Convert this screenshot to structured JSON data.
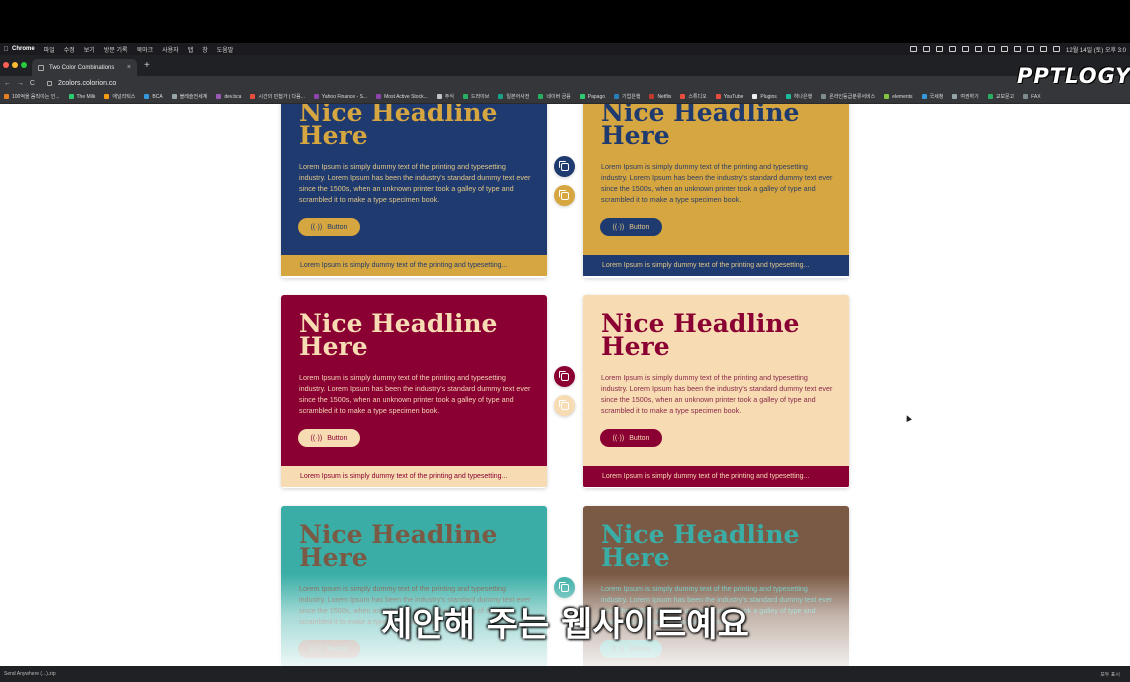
{
  "menubar": {
    "items": [
      "Chrome",
      "파일",
      "수정",
      "보기",
      "방문 기록",
      "북마크",
      "사용자",
      "탭",
      "창",
      "도움말"
    ],
    "clock": "12월 14일 (토) 오후 3:0"
  },
  "tab": {
    "title": "Two Color Combinations",
    "close": "×",
    "new_tab": "+"
  },
  "address": {
    "nav": "← → C",
    "url": "2colors.colorion.co"
  },
  "bookmarks": [
    {
      "label": "100억을 움직이는 인...",
      "color": "#e67e22"
    },
    {
      "label": "The Milk",
      "color": "#2ecc71"
    },
    {
      "label": "애널리틱스",
      "color": "#f39c12"
    },
    {
      "label": "BCA",
      "color": "#3498db"
    },
    {
      "label": "블레슬전세계",
      "color": "#95a5a6"
    },
    {
      "label": "dev.bca",
      "color": "#9b59b6"
    },
    {
      "label": "시간의 민첩가 | 다음...",
      "color": "#e74c3c"
    },
    {
      "label": "Yahoo Finance - S...",
      "color": "#8e44ad"
    },
    {
      "label": "Most Active Stock...",
      "color": "#8e44ad"
    },
    {
      "label": "주식",
      "color": "#bdc3c7"
    },
    {
      "label": "드라이브",
      "color": "#27ae60"
    },
    {
      "label": "일본어사전",
      "color": "#16a085"
    },
    {
      "label": "네이버 금융",
      "color": "#27ae60"
    },
    {
      "label": "Papago",
      "color": "#2ecc71"
    },
    {
      "label": "기업은행",
      "color": "#2980b9"
    },
    {
      "label": "Netflix",
      "color": "#c0392b"
    },
    {
      "label": "스튜디오",
      "color": "#e74c3c"
    },
    {
      "label": "YouTube",
      "color": "#e74c3c"
    },
    {
      "label": "Plugins",
      "color": "#ecf0f1"
    },
    {
      "label": "하나은행",
      "color": "#1abc9c"
    },
    {
      "label": "온라인등급분류서비스",
      "color": "#7f8c8d"
    },
    {
      "label": "elements",
      "color": "#82c341"
    },
    {
      "label": "국세청",
      "color": "#3498db"
    },
    {
      "label": "여권하기",
      "color": "#95a5a6"
    },
    {
      "label": "교보문고",
      "color": "#27ae60"
    },
    {
      "label": "FAX",
      "color": "#7f8c8d"
    }
  ],
  "watermark": "PPTLOGY",
  "cards": {
    "headline": "Nice Headline Here",
    "body": "Lorem Ipsum is simply dummy text of the printing and typesetting industry. Lorem Ipsum has been the industry's standard dummy text ever since the 1500s, when an unknown printer took a galley of type and scrambled it to make a type specimen book.",
    "button": "Button",
    "button_icon": "((·))",
    "footer": "Lorem Ipsum is simply dummy text of the printing and typesetting..."
  },
  "palette": [
    {
      "name": "navy-gold",
      "primary": "#1f3a6e",
      "secondary": "#d6a641"
    },
    {
      "name": "crimson-peach",
      "primary": "#8a0033",
      "secondary": "#f7dbb2"
    },
    {
      "name": "teal-brown",
      "primary": "#3aaea6",
      "secondary": "#7a5a45"
    }
  ],
  "subtitle": "제안해 주는 웹사이트예요",
  "download_bar": {
    "file": "Send Anywhere (...).zip",
    "right": "모두 표시"
  }
}
